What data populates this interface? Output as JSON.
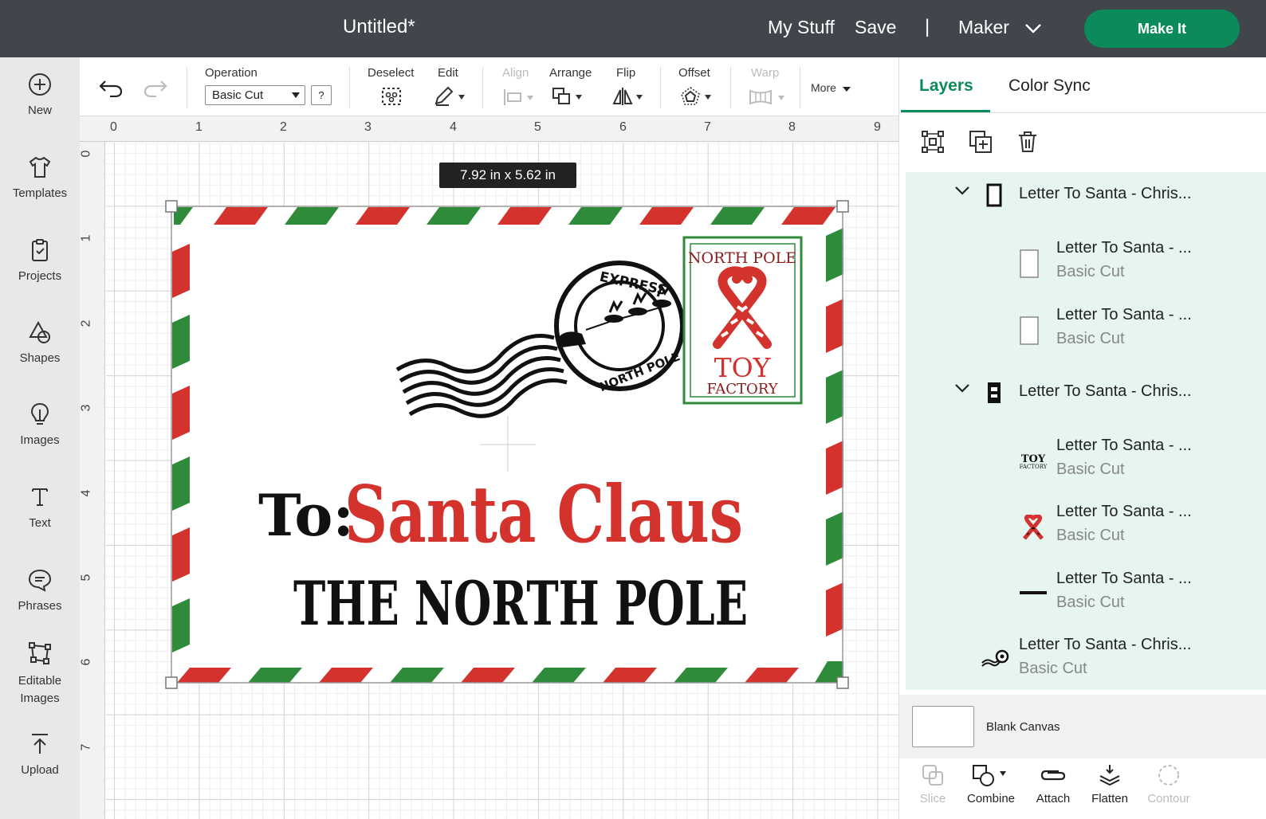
{
  "header": {
    "title": "Untitled*",
    "my_stuff": "My Stuff",
    "save": "Save",
    "divider": "|",
    "machine": "Maker",
    "make_it": "Make It"
  },
  "sidebar": {
    "items": [
      {
        "label": "New",
        "icon": "plus-circle-icon"
      },
      {
        "label": "Templates",
        "icon": "shirt-icon"
      },
      {
        "label": "Projects",
        "icon": "projects-icon"
      },
      {
        "label": "Shapes",
        "icon": "shapes-icon"
      },
      {
        "label": "Images",
        "icon": "lightbulb-icon"
      },
      {
        "label": "Text",
        "icon": "text-icon"
      },
      {
        "label": "Phrases",
        "icon": "speech-bubble-icon"
      },
      {
        "label": "Editable Images",
        "icon": "editable-images-icon"
      },
      {
        "label": "Upload",
        "icon": "upload-icon"
      }
    ]
  },
  "toolbar": {
    "operation_label": "Operation",
    "operation_value": "Basic Cut",
    "help": "?",
    "deselect": "Deselect",
    "edit": "Edit",
    "align": "Align",
    "arrange": "Arrange",
    "flip": "Flip",
    "offset": "Offset",
    "warp": "Warp",
    "more": "More"
  },
  "canvas": {
    "ruler_top": [
      "0",
      "1",
      "2",
      "3",
      "4",
      "5",
      "6",
      "7",
      "8",
      "9"
    ],
    "ruler_left": [
      "0",
      "1",
      "2",
      "3",
      "4",
      "5",
      "6",
      "7"
    ],
    "size_readout": "7.92  in x 5.62  in",
    "design": {
      "stamp_top": "NORTH POLE",
      "stamp_bottom_1": "TOY",
      "stamp_bottom_2": "FACTORY",
      "postmark_top": "EXPRESS",
      "postmark_bottom": "NORTH POLE",
      "to": "To:",
      "recipient": "Santa Claus",
      "address": "THE NORTH POLE",
      "red": "#d3322d",
      "green": "#2e8b3a"
    }
  },
  "layers_panel": {
    "tabs": [
      "Layers",
      "Color Sync"
    ],
    "layers": [
      {
        "type": "group",
        "name": "Letter To Santa - Chris..."
      },
      {
        "type": "child",
        "name": "Letter To Santa - ...",
        "op": "Basic Cut"
      },
      {
        "type": "child",
        "name": "Letter To Santa - ...",
        "op": "Basic Cut"
      },
      {
        "type": "group",
        "name": "Letter To Santa - Chris..."
      },
      {
        "type": "child",
        "name": "Letter To Santa - ...",
        "op": "Basic Cut"
      },
      {
        "type": "child",
        "name": "Letter To Santa - ...",
        "op": "Basic Cut"
      },
      {
        "type": "child",
        "name": "Letter To Santa - ...",
        "op": "Basic Cut"
      },
      {
        "type": "item",
        "name": "Letter To Santa - Chris...",
        "op": "Basic Cut"
      }
    ],
    "blank_canvas": "Blank Canvas",
    "bottom_tools": [
      {
        "label": "Slice",
        "enabled": false
      },
      {
        "label": "Combine",
        "enabled": true
      },
      {
        "label": "Attach",
        "enabled": true
      },
      {
        "label": "Flatten",
        "enabled": true
      },
      {
        "label": "Contour",
        "enabled": false
      }
    ]
  },
  "colors": {
    "accent": "#0b8a5a",
    "header_bg": "#41464d"
  }
}
